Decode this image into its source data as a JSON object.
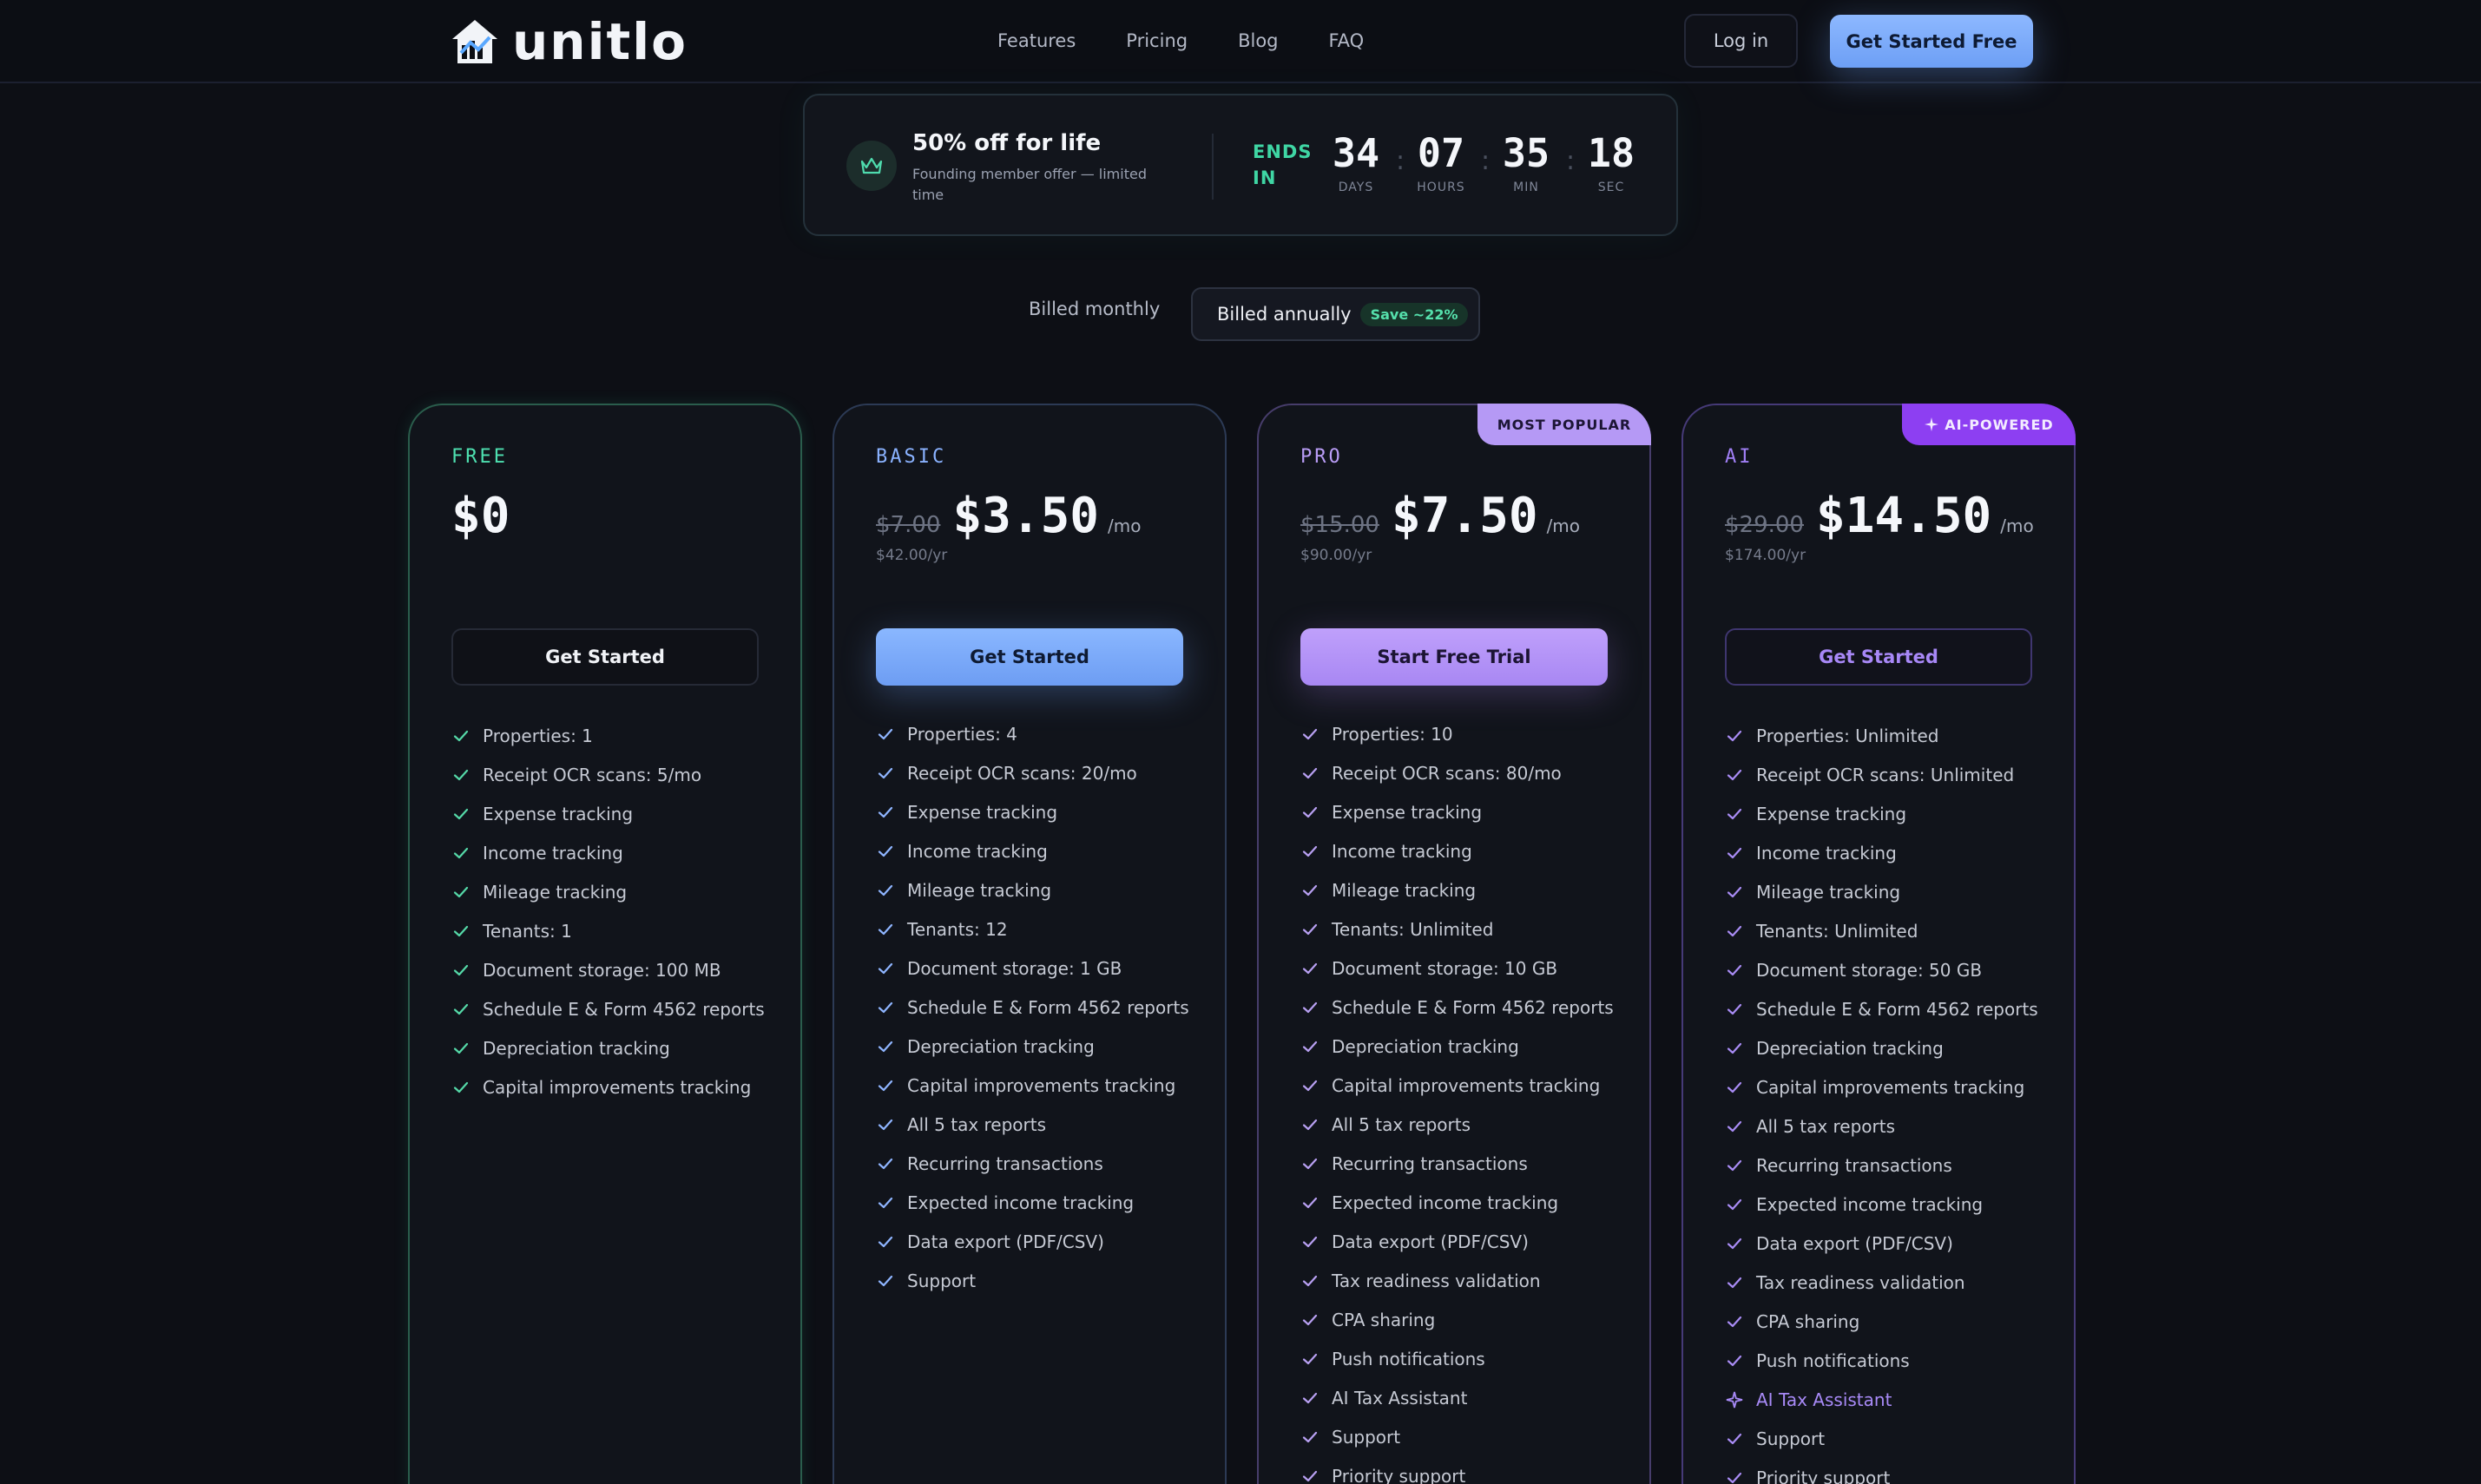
{
  "brand": {
    "name": "unitlo"
  },
  "nav": {
    "links": [
      "Features",
      "Pricing",
      "Blog",
      "FAQ"
    ],
    "login": "Log in",
    "cta": "Get Started Free"
  },
  "promo": {
    "title": "50% off for life",
    "subtitle": "Founding member offer — limited time",
    "ends_label": "ENDS IN",
    "countdown": [
      {
        "value": "34",
        "label": "DAYS"
      },
      {
        "value": "07",
        "label": "HOURS"
      },
      {
        "value": "35",
        "label": "MIN"
      },
      {
        "value": "18",
        "label": "SEC"
      }
    ]
  },
  "billing": {
    "monthly": "Billed monthly",
    "annually": "Billed annually",
    "save_badge": "Save ~22%",
    "selected": "annually"
  },
  "colors": {
    "free_accent": "#4ee0b0",
    "basic_accent": "#8ab2ff",
    "pro_accent": "#b99cf6",
    "ai_accent": "#8d3ff2",
    "background": "#0d0f15"
  },
  "plans": [
    {
      "id": "free",
      "name": "FREE",
      "old_price": "",
      "price": "$0",
      "per": "",
      "yearly": "",
      "button": "Get Started",
      "features": [
        "Properties: 1",
        "Receipt OCR scans: 5/mo",
        "Expense tracking",
        "Income tracking",
        "Mileage tracking",
        "Tenants: 1",
        "Document storage: 100 MB",
        "Schedule E & Form 4562 reports",
        "Depreciation tracking",
        "Capital improvements tracking"
      ]
    },
    {
      "id": "basic",
      "name": "BASIC",
      "old_price": "$7.00",
      "price": "$3.50",
      "per": "/mo",
      "yearly": "$42.00/yr",
      "button": "Get Started",
      "features": [
        "Properties: 4",
        "Receipt OCR scans: 20/mo",
        "Expense tracking",
        "Income tracking",
        "Mileage tracking",
        "Tenants: 12",
        "Document storage: 1 GB",
        "Schedule E & Form 4562 reports",
        "Depreciation tracking",
        "Capital improvements tracking",
        "All 5 tax reports",
        "Recurring transactions",
        "Expected income tracking",
        "Data export (PDF/CSV)",
        "Support"
      ]
    },
    {
      "id": "pro",
      "name": "PRO",
      "badge": "MOST POPULAR",
      "old_price": "$15.00",
      "price": "$7.50",
      "per": "/mo",
      "yearly": "$90.00/yr",
      "button": "Start Free Trial",
      "features": [
        "Properties: 10",
        "Receipt OCR scans: 80/mo",
        "Expense tracking",
        "Income tracking",
        "Mileage tracking",
        "Tenants: Unlimited",
        "Document storage: 10 GB",
        "Schedule E & Form 4562 reports",
        "Depreciation tracking",
        "Capital improvements tracking",
        "All 5 tax reports",
        "Recurring transactions",
        "Expected income tracking",
        "Data export (PDF/CSV)",
        "Tax readiness validation",
        "CPA sharing",
        "Push notifications",
        "AI Tax Assistant",
        "Support",
        "Priority support"
      ]
    },
    {
      "id": "ai",
      "name": "AI",
      "badge": "AI-POWERED",
      "old_price": "$29.00",
      "price": "$14.50",
      "per": "/mo",
      "yearly": "$174.00/yr",
      "button": "Get Started",
      "features": [
        "Properties: Unlimited",
        "Receipt OCR scans: Unlimited",
        "Expense tracking",
        "Income tracking",
        "Mileage tracking",
        "Tenants: Unlimited",
        "Document storage: 50 GB",
        "Schedule E & Form 4562 reports",
        "Depreciation tracking",
        "Capital improvements tracking",
        "All 5 tax reports",
        "Recurring transactions",
        "Expected income tracking",
        "Data export (PDF/CSV)",
        "Tax readiness validation",
        "CPA sharing",
        "Push notifications",
        "AI Tax Assistant",
        "Support",
        "Priority support"
      ],
      "highlight_feature": "AI Tax Assistant"
    }
  ]
}
